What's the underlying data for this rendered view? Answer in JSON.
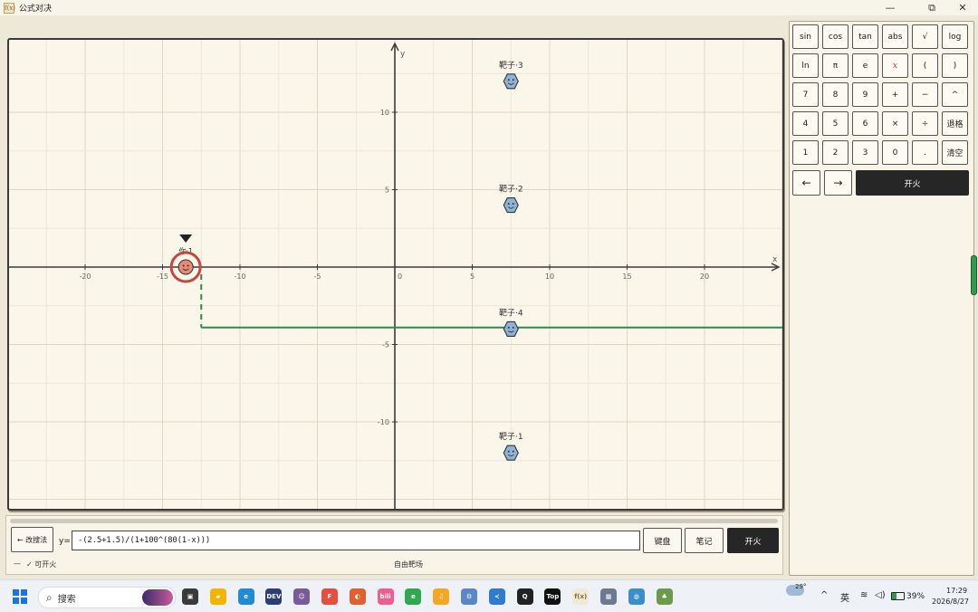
{
  "window": {
    "title": "公式对决",
    "app_icon_glyph": "f(x)",
    "controls": [
      "—",
      "⧉",
      "✕"
    ]
  },
  "plot": {
    "x_axis_label": "x",
    "y_axis_label": "y",
    "x_ticks": [
      "-20",
      "-15",
      "-10",
      "-5",
      "0",
      "5",
      "10",
      "15",
      "20"
    ],
    "y_ticks": [
      "10",
      "5",
      "-5",
      "-10"
    ],
    "targets": [
      {
        "label": "靶子·3",
        "x": 7.5,
        "y": 12
      },
      {
        "label": "靶子·2",
        "x": 7.5,
        "y": 4
      },
      {
        "label": "靶子·4",
        "x": 7.5,
        "y": -4
      },
      {
        "label": "靶子·1",
        "x": 7.5,
        "y": -12
      }
    ],
    "shooter": {
      "label": "你·1",
      "x": -13.5,
      "y": 0
    },
    "curve_level": -3.9,
    "curve_start_x": -12.5,
    "colors": {
      "curve": "#2e8a4f",
      "shooter_ring": "#c8453f",
      "target": "#8fb3d6"
    }
  },
  "bottom": {
    "back_button": "← 改搜法",
    "y_prefix": "y=",
    "formula": "-(2.5+1.5)/(1+100^(80(1-x)))",
    "keyboard_button": "键盘",
    "notes_button": "笔记",
    "fire_button": "开火",
    "status_dash": "—",
    "status_ready": "✓ 可开火",
    "mode": "自由靶场"
  },
  "keypad": {
    "rows": [
      [
        "sin",
        "cos",
        "tan",
        "abs",
        "√",
        "log"
      ],
      [
        "ln",
        "π",
        "e",
        "x",
        "(",
        ")"
      ],
      [
        "7",
        "8",
        "9",
        "+",
        "−",
        "^"
      ],
      [
        "4",
        "5",
        "6",
        "×",
        "÷",
        "退格"
      ],
      [
        "1",
        "2",
        "3",
        "0",
        ".",
        "清空"
      ]
    ],
    "left_arrow": "←",
    "right_arrow": "→",
    "fire": "开火"
  },
  "taskbar": {
    "search_placeholder": "搜索",
    "temperature": "29°",
    "ime": "英",
    "battery": "39%",
    "time": "17:29",
    "date": "2026/8/27",
    "apps": [
      "files",
      "explorer",
      "edge",
      "dev",
      "avatar",
      "figma",
      "app-orange",
      "bilibili",
      "edge-green",
      "notes",
      "settings",
      "vscode",
      "qq",
      "typora",
      "formula-duel",
      "calculator",
      "globe",
      "game"
    ]
  }
}
